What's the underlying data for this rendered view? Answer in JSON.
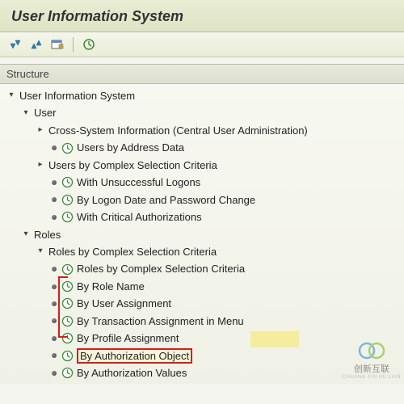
{
  "header": {
    "title": "User Information System"
  },
  "section": {
    "label": "Structure"
  },
  "tree": {
    "root": "User Information System",
    "user": {
      "label": "User",
      "cross": "Cross-System Information (Central User Administration)",
      "byAddress": "Users by Address Data",
      "byComplex": "Users by Complex Selection Criteria",
      "withUnsuccessful": "With Unsuccessful Logons",
      "byLogonDate": "By Logon Date and Password Change",
      "withCritical": "With Critical Authorizations"
    },
    "roles": {
      "label": "Roles",
      "byComplex": "Roles by Complex Selection Criteria",
      "byComplex2": "Roles by Complex Selection Criteria",
      "byRoleName": "By Role Name",
      "byUserAssign": "By User Assignment",
      "byTxAssign": "By Transaction Assignment in Menu",
      "byProfileAssign": "By Profile Assignment",
      "byAuthObject": "By Authorization Object",
      "byAuthValues": "By Authorization Values"
    }
  },
  "watermark": {
    "text": "创新互联",
    "sub": "CHUANG XIN HU LIAN"
  }
}
